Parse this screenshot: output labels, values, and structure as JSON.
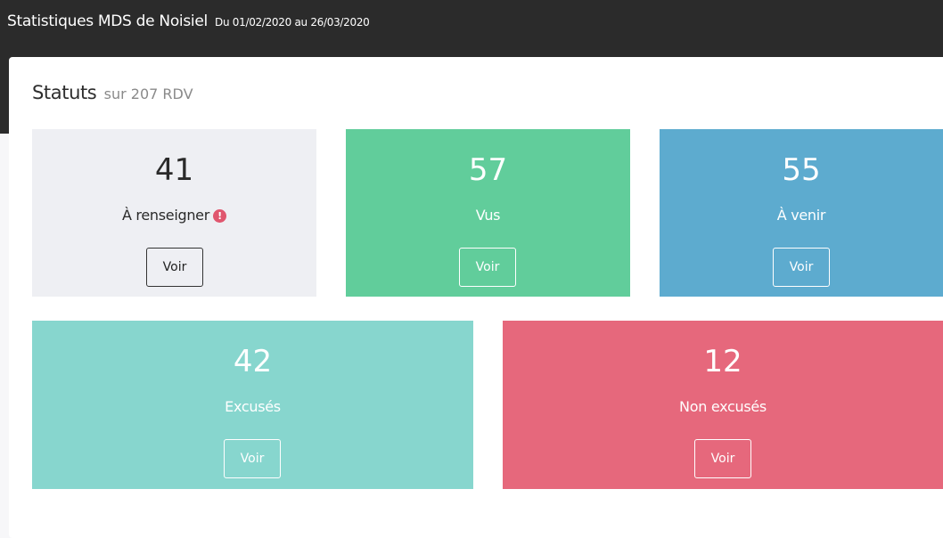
{
  "header": {
    "title": "Statistiques MDS de Noisiel",
    "date_range": "Du 01/02/2020 au 26/03/2020"
  },
  "statuts": {
    "title": "Statuts",
    "subtitle": "sur 207 RDV"
  },
  "colors": {
    "a_renseigner": "#eeeff3",
    "vus": "#61cd9b",
    "a_venir": "#5dabcf",
    "excuses": "#87d6ce",
    "non_excuses": "#e6687c",
    "header_bg": "#2b2b2b"
  },
  "stats": [
    {
      "id": "a-renseigner",
      "count": "41",
      "label": "À renseigner",
      "icon": "exclamation-circle-icon",
      "button": "Voir"
    },
    {
      "id": "vus",
      "count": "57",
      "label": "Vus",
      "button": "Voir"
    },
    {
      "id": "a-venir",
      "count": "55",
      "label": "À venir",
      "button": "Voir"
    },
    {
      "id": "excuses",
      "count": "42",
      "label": "Excusés",
      "button": "Voir"
    },
    {
      "id": "non-excuses",
      "count": "12",
      "label": "Non excusés",
      "button": "Voir"
    }
  ]
}
